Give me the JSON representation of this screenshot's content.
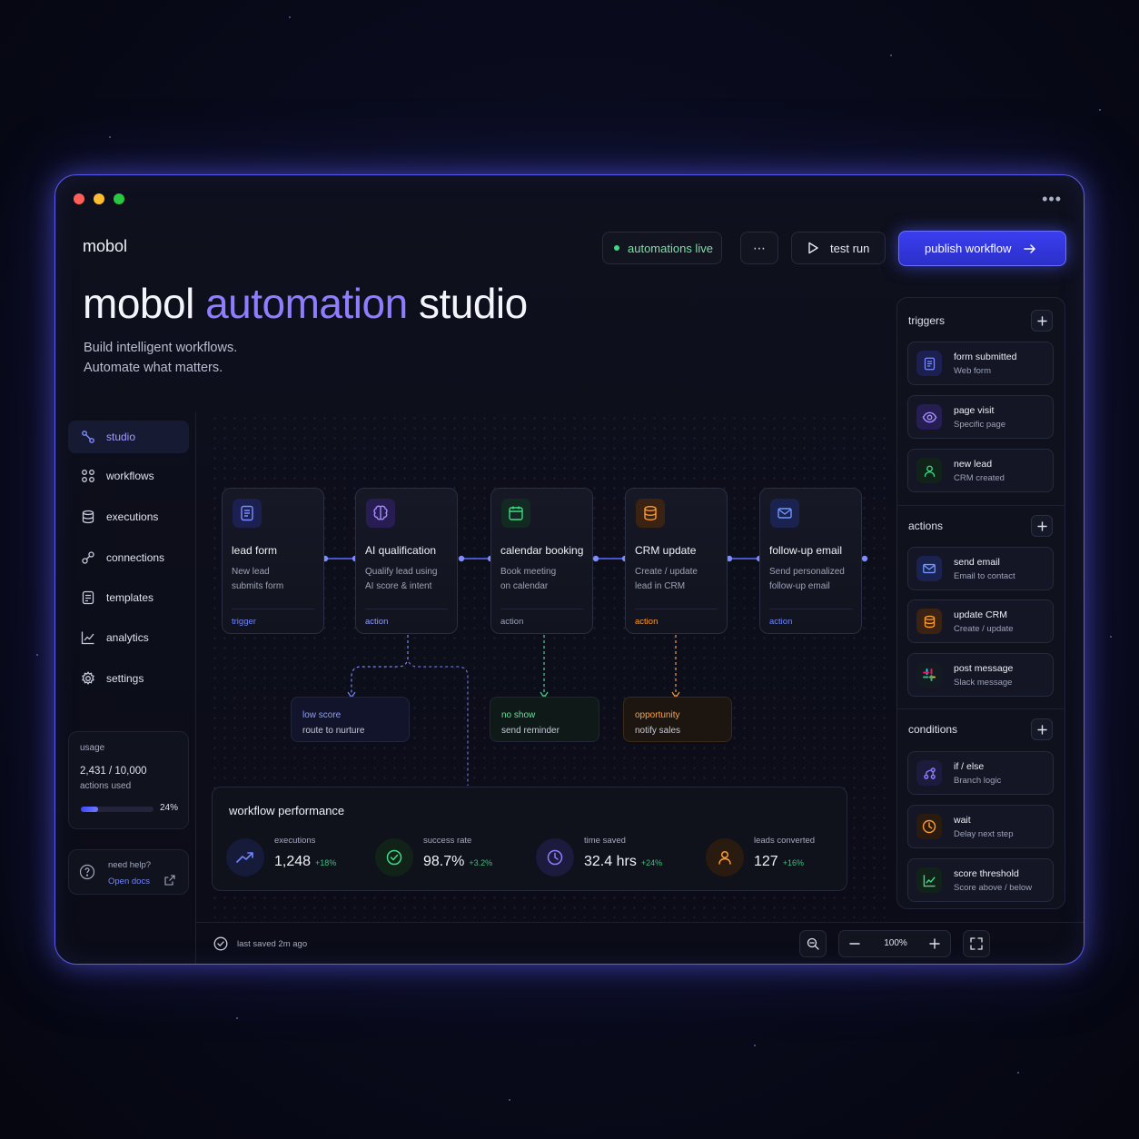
{
  "window": {
    "brand": "mobol"
  },
  "header": {
    "status": "automations live",
    "more": "⋯",
    "test_run": "test run",
    "publish": "publish workflow"
  },
  "hero": {
    "title_part1": "mobol",
    "title_accent": "automation",
    "title_part2": "studio",
    "subtitle_line1": "Build intelligent workflows.",
    "subtitle_line2": "Automate what matters."
  },
  "sidebar": {
    "items": [
      {
        "label": "studio",
        "icon": "studio-icon",
        "active": true
      },
      {
        "label": "workflows",
        "icon": "grid-icon"
      },
      {
        "label": "executions",
        "icon": "database-icon"
      },
      {
        "label": "connections",
        "icon": "link-icon"
      },
      {
        "label": "templates",
        "icon": "template-icon"
      },
      {
        "label": "analytics",
        "icon": "chart-icon"
      },
      {
        "label": "settings",
        "icon": "gear-icon"
      }
    ],
    "usage": {
      "title": "usage",
      "count": "2,431 / 10,000",
      "unit": "actions used",
      "percent": "24%",
      "fraction": 0.24
    },
    "help": {
      "title": "need help?",
      "link": "Open docs"
    }
  },
  "workflow": {
    "nodes": [
      {
        "title": "lead form",
        "desc1": "New lead",
        "desc2": "submits form",
        "tag": "trigger",
        "color": "#5b6cff"
      },
      {
        "title": "AI qualification",
        "desc1": "Qualify lead using",
        "desc2": "AI score & intent",
        "tag": "action",
        "color": "#8f7cff"
      },
      {
        "title": "calendar booking",
        "desc1": "Book meeting",
        "desc2": "on calendar",
        "tag": "action",
        "color": "#3ddc84"
      },
      {
        "title": "CRM update",
        "desc1": "Create / update",
        "desc2": "lead in CRM",
        "tag": "action",
        "color": "#ff9a2e"
      },
      {
        "title": "follow-up email",
        "desc1": "Send personalized",
        "desc2": "follow-up email",
        "tag": "action",
        "color": "#5b8cff"
      }
    ],
    "branches": [
      {
        "title": "low score",
        "desc": "route to nurture",
        "color": "#8f9dff"
      },
      {
        "title": "no show",
        "desc": "send reminder",
        "color": "#5fe29a"
      },
      {
        "title": "opportunity",
        "desc": "notify sales",
        "color": "#ffa23a"
      }
    ]
  },
  "performance": {
    "title": "workflow performance",
    "metrics": [
      {
        "label": "executions",
        "value": "1,248",
        "delta": "+18%",
        "icon": "trend-up-icon"
      },
      {
        "label": "success rate",
        "value": "98.7%",
        "delta": "+3.2%",
        "icon": "check-circle-icon"
      },
      {
        "label": "time saved",
        "value": "32.4 hrs",
        "delta": "+24%",
        "icon": "clock-icon"
      },
      {
        "label": "leads converted",
        "value": "127",
        "delta": "+16%",
        "icon": "user-icon"
      }
    ]
  },
  "footer": {
    "saved": "last saved 2m ago",
    "zoom": "100%"
  },
  "panel": {
    "triggers": {
      "title": "triggers",
      "items": [
        {
          "title": "form submitted",
          "sub": "Web form",
          "icon": "form-icon"
        },
        {
          "title": "page visit",
          "sub": "Specific page",
          "icon": "eye-icon"
        },
        {
          "title": "new lead",
          "sub": "CRM created",
          "icon": "user-icon"
        }
      ]
    },
    "actions": {
      "title": "actions",
      "items": [
        {
          "title": "send email",
          "sub": "Email to contact",
          "icon": "mail-icon"
        },
        {
          "title": "update CRM",
          "sub": "Create / update",
          "icon": "database-icon"
        },
        {
          "title": "post message",
          "sub": "Slack message",
          "icon": "slack-icon"
        }
      ]
    },
    "conditions": {
      "title": "conditions",
      "items": [
        {
          "title": "if / else",
          "sub": "Branch logic",
          "icon": "branch-icon"
        },
        {
          "title": "wait",
          "sub": "Delay next step",
          "icon": "clock-icon"
        },
        {
          "title": "score threshold",
          "sub": "Score above / below",
          "icon": "chart-icon"
        }
      ]
    }
  },
  "colors": {
    "accent": "#8f7cff",
    "primary": "#3a3ef0",
    "success": "#3ddc84",
    "warning": "#ff9a2e"
  }
}
